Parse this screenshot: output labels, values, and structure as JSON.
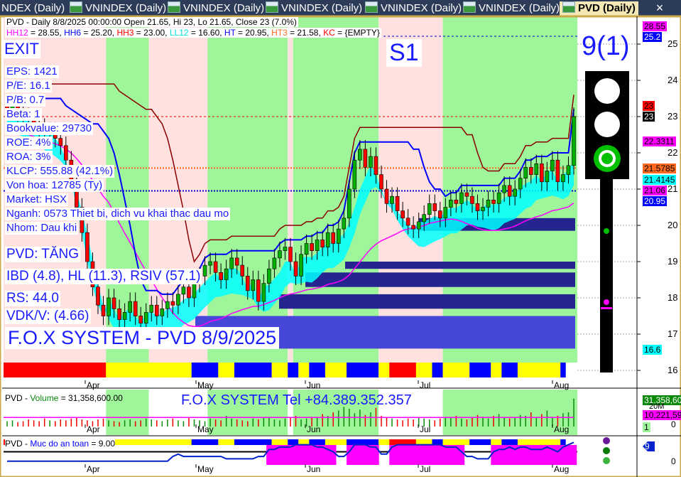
{
  "tabs": [
    "NDEX (Daily)",
    "VNINDEX (Daily)",
    "VNINDEX (Daily)",
    "VNINDEX (Daily)",
    "VNINDEX (Daily)",
    "VNINDEX (Daily)",
    "PVD (Daily)"
  ],
  "close_tab": "×",
  "header": {
    "line1": "PVD - Daily 8/8/2025 00:00:00 Open 21.65, Hi 23, Lo 21.65, Close 23 (7.0%)",
    "hh12": "HH12",
    "hh12_val": " = 28.55, ",
    "hh6": "HH6",
    "hh6_val": " = 25.20, ",
    "hh3": "HH3",
    "hh3_val": " = 23.00, ",
    "ll12": "LL12",
    "ll12_val": " = 16.60, ",
    "ht": "HT",
    "ht_val": "  = 20.95, ",
    "ht3": "HT3",
    "ht3_val": "  = 21.58, ",
    "kc": "KC",
    "kc_val": " = {EMPTY}"
  },
  "labels": {
    "exit": "EXIT",
    "s1": "S1",
    "signal": "9(1)",
    "trend": "PVD: TĂNG",
    "ibd": "IBD (4.8), HL (11.3), RSIV (57.1)",
    "rs": "RS: 44.0",
    "vdk": "VDK/V:  (4.66)",
    "system": "F.O.X SYSTEM - PVD 8/9/2025",
    "tel": "F.O.X SYSTEM Tel +84.389.352.357"
  },
  "fundamentals": [
    "EPS: 1421",
    "P/E: 16.1",
    "P/B: 0.7",
    "Beta: 1",
    "Bookvalue: 29730",
    "ROE: 4%",
    "ROA: 3%",
    "KLCP: 555.88 (42.1%)",
    "Von hoa: 12785 (Ty)",
    "Market: HSX",
    "Nganh: 0573 Thiet bi, dich vu khai thac dau mo",
    "Nhom: Dau khi"
  ],
  "axis_boxes": [
    {
      "text": "28.55",
      "bg": "#ff00ff",
      "fg": "#000"
    },
    {
      "text": "25.2",
      "bg": "#0000ff",
      "fg": "#fff"
    },
    {
      "text": "23",
      "bg": "#ff0000",
      "fg": "#000"
    },
    {
      "text": "23",
      "bg": "#000000",
      "fg": "#fff"
    },
    {
      "text": "22.3311",
      "bg": "#ff00ff",
      "fg": "#000"
    },
    {
      "text": "21.5785",
      "bg": "#ff6a20",
      "fg": "#000"
    },
    {
      "text": "21.4145",
      "bg": "#00ffff",
      "fg": "#000"
    },
    {
      "text": "21.06",
      "bg": "#ff00ff",
      "fg": "#000"
    },
    {
      "text": "20.95",
      "bg": "#0000ff",
      "fg": "#fff"
    },
    {
      "text": "16.6",
      "bg": "#00ffff",
      "fg": "#000"
    }
  ],
  "volume_pane": {
    "title_prefix": "PVD - ",
    "title_name": "Volume",
    "title_value": " = 31,358,600.00",
    "box_volume": "31,358,60",
    "box_ma": "10,221,59",
    "tick_20m": "20M",
    "tick_0": "0",
    "box_1": "1"
  },
  "safety_pane": {
    "title_prefix": "PVD - ",
    "title_name": "Muc do an toan",
    "title_value": " = 9.00",
    "box_value": "9",
    "tick_0": "0"
  },
  "chart_data": {
    "type": "candlestick",
    "title": "PVD - Daily",
    "y_ticks": [
      16,
      17,
      18,
      19,
      20,
      21,
      22,
      23,
      24,
      25
    ],
    "ylim": [
      15.9,
      25.6
    ],
    "x_months": [
      "Apr",
      "May",
      "Jun",
      "Jul",
      "Aug"
    ],
    "close": [
      23.2,
      23.3,
      23.1,
      23.0,
      22.9,
      22.8,
      22.7,
      22.5,
      22.6,
      22.4,
      22.2,
      21.8,
      21.2,
      20.5,
      19.8,
      19.0,
      18.3,
      17.8,
      17.5,
      18.0,
      17.7,
      17.4,
      17.6,
      17.9,
      17.5,
      17.3,
      17.6,
      17.8,
      17.5,
      17.7,
      17.9,
      17.8,
      18.1,
      18.3,
      18.0,
      18.4,
      18.6,
      18.9,
      19.0,
      18.7,
      18.5,
      18.8,
      19.1,
      18.9,
      18.6,
      18.2,
      18.5,
      17.9,
      18.4,
      18.8,
      19.1,
      19.3,
      19.4,
      19.0,
      18.6,
      19.2,
      19.5,
      19.3,
      19.6,
      19.4,
      19.8,
      19.5,
      19.9,
      20.2,
      21.0,
      21.8,
      22.1,
      21.6,
      21.9,
      21.4,
      21.0,
      20.6,
      20.8,
      20.4,
      20.2,
      20.0,
      19.9,
      20.1,
      20.3,
      20.6,
      20.4,
      20.2,
      20.5,
      20.7,
      20.6,
      20.9,
      20.8,
      20.6,
      20.4,
      20.5,
      20.7,
      20.6,
      20.9,
      21.1,
      20.8,
      21.0,
      21.3,
      21.6,
      21.4,
      21.7,
      21.2,
      21.5,
      21.8,
      21.2,
      21.4,
      21.65,
      23.0
    ],
    "support_zones": [
      [
        19.85,
        20.2
      ],
      [
        18.8,
        19.0
      ],
      [
        18.3,
        18.7
      ],
      [
        17.7,
        18.1
      ],
      [
        16.6,
        17.5
      ]
    ],
    "levels": {
      "HH3": 23.0,
      "HT3": 21.58,
      "HT": 20.95
    },
    "background_regions": [
      {
        "from": 0,
        "to": 19,
        "state": "bear"
      },
      {
        "from": 19,
        "to": 27,
        "state": "bull"
      },
      {
        "from": 27,
        "to": 38,
        "state": "bear"
      },
      {
        "from": 38,
        "to": 53,
        "state": "bull"
      },
      {
        "from": 53,
        "to": 54,
        "state": "bear"
      },
      {
        "from": 54,
        "to": 70,
        "state": "bull"
      },
      {
        "from": 70,
        "to": 82,
        "state": "bear"
      },
      {
        "from": 82,
        "to": 107,
        "state": "bull"
      }
    ],
    "signal_strip": [
      [
        "#ff0000",
        19
      ],
      [
        "#ffff00",
        16
      ],
      [
        "#0000ff",
        5
      ],
      [
        "#ffff00",
        3
      ],
      [
        "#0000ff",
        7
      ],
      [
        "#ffff00",
        3
      ],
      [
        "#0000ff",
        2
      ],
      [
        "#ffff00",
        2
      ],
      [
        "#0000ff",
        3
      ],
      [
        "#ffff00",
        4
      ],
      [
        "#0000ff",
        6
      ],
      [
        "#ffff00",
        2
      ],
      [
        "#ff0000",
        5
      ],
      [
        "#ffff00",
        3
      ],
      [
        "#0000ff",
        2
      ],
      [
        "#ffff00",
        5
      ],
      [
        "#0000ff",
        4
      ],
      [
        "#ffff00",
        2
      ],
      [
        "#0000ff",
        3
      ],
      [
        "#ffff00",
        8
      ],
      [
        "#0000ff",
        1
      ]
    ],
    "volume_millions": [
      6,
      7,
      5,
      6,
      8,
      7,
      6,
      9,
      7,
      6,
      8,
      7,
      9,
      10,
      8,
      7,
      6,
      8,
      9,
      7,
      6,
      5,
      7,
      8,
      6,
      7,
      9,
      8,
      7,
      6,
      8,
      9,
      7,
      6,
      10,
      8,
      7,
      6,
      9,
      8,
      7,
      12,
      9,
      8,
      7,
      6,
      9,
      8,
      10,
      11,
      8,
      7,
      9,
      10,
      12,
      8,
      9,
      11,
      10,
      14,
      12,
      16,
      18,
      22,
      20,
      15,
      19,
      13,
      16,
      21,
      12,
      10,
      9,
      8,
      7,
      9,
      8,
      10,
      9,
      8,
      7,
      9,
      11,
      10,
      12,
      9,
      8,
      10,
      13,
      11,
      9,
      12,
      14,
      10,
      9,
      11,
      13,
      12,
      16,
      10,
      14,
      18,
      11,
      12,
      15,
      16,
      31.36
    ],
    "volume_ma_millions": 10.22,
    "safety_level": [
      1,
      1,
      1,
      1,
      1,
      1,
      1,
      1,
      1,
      1,
      1,
      1,
      1,
      1,
      1,
      1,
      1,
      1,
      1,
      1,
      1,
      1,
      1,
      1,
      1,
      1,
      1,
      1,
      1,
      1,
      1,
      3,
      4,
      3,
      3,
      3,
      3,
      3,
      3,
      3,
      3,
      2,
      2,
      2,
      2,
      2,
      2,
      3,
      3,
      6,
      6,
      7,
      7,
      7,
      8,
      8,
      8,
      8,
      7,
      7,
      6,
      5,
      3,
      3,
      5,
      8,
      8,
      8,
      7,
      7,
      4,
      4,
      7,
      8,
      8,
      8,
      8,
      8,
      8,
      8,
      8,
      8,
      7,
      7,
      7,
      5,
      3,
      3,
      2,
      2,
      2,
      5,
      6,
      6,
      7,
      6,
      7,
      7,
      6,
      6,
      6,
      7,
      6,
      5,
      7,
      8,
      9
    ],
    "safety_threshold": 5
  }
}
